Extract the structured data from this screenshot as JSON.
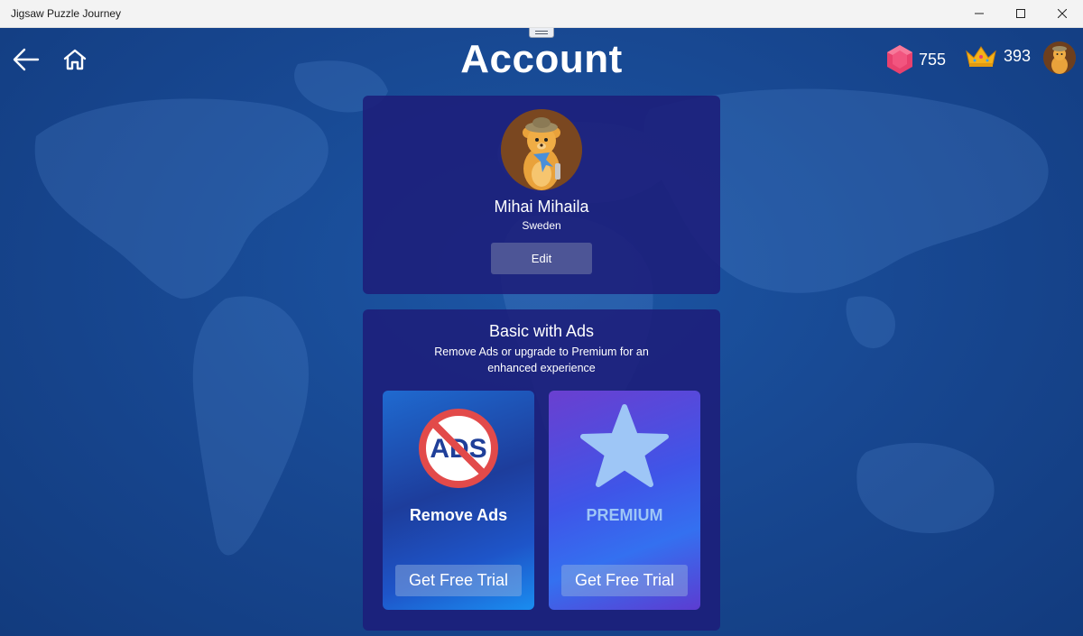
{
  "window": {
    "title": "Jigsaw Puzzle Journey"
  },
  "header": {
    "title": "Account",
    "gems": "755",
    "crowns": "393"
  },
  "profile": {
    "name": "Mihai Mihaila",
    "country": "Sweden",
    "edit_label": "Edit"
  },
  "plan": {
    "title": "Basic with Ads",
    "description": "Remove Ads or upgrade to Premium for an enhanced experience",
    "cards": [
      {
        "label": "Remove Ads",
        "button_label": "Get Free Trial",
        "icon": "no-ads-icon"
      },
      {
        "label": "PREMIUM",
        "button_label": "Get Free Trial",
        "icon": "star-icon"
      }
    ],
    "no_ads_text": "ADS"
  },
  "colors": {
    "background": "#17468f",
    "panel": "#1c1e7a",
    "gem": "#e8416e",
    "crown": "#f5b21a",
    "premium_label": "#9ec6f6"
  }
}
